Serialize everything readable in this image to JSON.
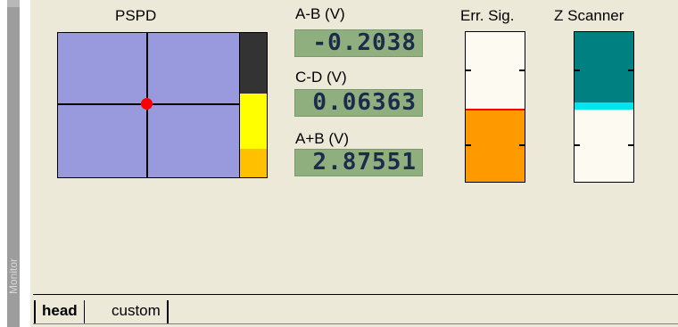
{
  "sidebar": {
    "label": "Monitor"
  },
  "pspd": {
    "title": "PSPD",
    "sum_fill_yellow": 0.58,
    "sum_fill_orange": 0.2
  },
  "readouts": [
    {
      "label": "A-B (V)",
      "value": "-0.2038"
    },
    {
      "label": "C-D (V)",
      "value": "0.06363"
    },
    {
      "label": "A+B (V)",
      "value": "2.87551"
    }
  ],
  "err_sig": {
    "title": "Err. Sig.",
    "level": 0.48,
    "fill_color": "#ff9900",
    "line_color": "#ff0000"
  },
  "z_scanner": {
    "title": "Z Scanner",
    "level": 0.47,
    "fill_color": "#008080",
    "line_color": "#00e5ee"
  },
  "tabs": [
    {
      "label": "head",
      "active": true
    },
    {
      "label": "custom",
      "active": false
    }
  ]
}
